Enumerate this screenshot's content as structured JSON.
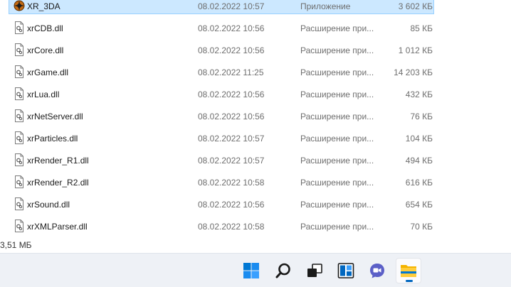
{
  "files": [
    {
      "name": "XR_3DA",
      "date": "08.02.2022 10:57",
      "type": "Приложение",
      "size": "3 602 КБ",
      "icon": "app-icon",
      "selected": true
    },
    {
      "name": "xrCDB.dll",
      "date": "08.02.2022 10:56",
      "type": "Расширение при...",
      "size": "85 КБ",
      "icon": "dll-file-icon"
    },
    {
      "name": "xrCore.dll",
      "date": "08.02.2022 10:56",
      "type": "Расширение при...",
      "size": "1 012 КБ",
      "icon": "dll-file-icon"
    },
    {
      "name": "xrGame.dll",
      "date": "08.02.2022 11:25",
      "type": "Расширение при...",
      "size": "14 203 КБ",
      "icon": "dll-file-icon"
    },
    {
      "name": "xrLua.dll",
      "date": "08.02.2022 10:56",
      "type": "Расширение при...",
      "size": "432 КБ",
      "icon": "dll-file-icon"
    },
    {
      "name": "xrNetServer.dll",
      "date": "08.02.2022 10:56",
      "type": "Расширение при...",
      "size": "76 КБ",
      "icon": "dll-file-icon"
    },
    {
      "name": "xrParticles.dll",
      "date": "08.02.2022 10:57",
      "type": "Расширение при...",
      "size": "104 КБ",
      "icon": "dll-file-icon"
    },
    {
      "name": "xrRender_R1.dll",
      "date": "08.02.2022 10:57",
      "type": "Расширение при...",
      "size": "494 КБ",
      "icon": "dll-file-icon"
    },
    {
      "name": "xrRender_R2.dll",
      "date": "08.02.2022 10:58",
      "type": "Расширение при...",
      "size": "616 КБ",
      "icon": "dll-file-icon"
    },
    {
      "name": "xrSound.dll",
      "date": "08.02.2022 10:56",
      "type": "Расширение при...",
      "size": "654 КБ",
      "icon": "dll-file-icon"
    },
    {
      "name": "xrXMLParser.dll",
      "date": "08.02.2022 10:58",
      "type": "Расширение при...",
      "size": "70 КБ",
      "icon": "dll-file-icon"
    }
  ],
  "status_bar": {
    "selection_size": "3,51 МБ"
  },
  "taskbar": {
    "items": [
      {
        "icon": "windows-start-icon"
      },
      {
        "icon": "search-icon"
      },
      {
        "icon": "task-view-icon"
      },
      {
        "icon": "widgets-icon"
      },
      {
        "icon": "teams-chat-icon"
      },
      {
        "icon": "file-explorer-icon",
        "active": true
      }
    ]
  },
  "colors": {
    "selection_bg": "#cce8ff",
    "taskbar_bg": "#eef1f6",
    "accent": "#0067c0"
  }
}
